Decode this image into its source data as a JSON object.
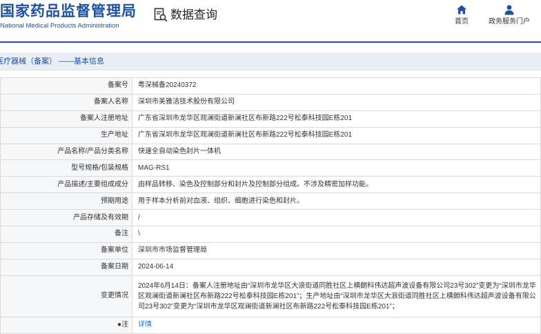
{
  "header": {
    "logo_cn": "国家药品监督管理局",
    "logo_en": "National Medical Products Administration",
    "data_query": "数据查询",
    "nav": {
      "home": "首页",
      "portal": "政务服务门户"
    }
  },
  "section": {
    "title": "医疗器械（备案） ——基本信息"
  },
  "colors": {
    "brand": "#1d4fa3",
    "link": "#1d6fd1"
  },
  "rows": [
    {
      "label": "备案号",
      "value": "粤深械备20240372"
    },
    {
      "label": "备案人名称",
      "value": "深圳市美雅洁技术股份有限公司"
    },
    {
      "label": "备案人注册地址",
      "value": "广东省深圳市龙华区观澜街道新澜社区布新路222号松泰科技园E栋201"
    },
    {
      "label": "生产地址",
      "value": "广东省深圳市龙华区观澜街道新澜社区布新路222号松泰科技园E栋201"
    },
    {
      "label": "产品名称/产品分类名称",
      "value": "快速全自动染色封片一体机"
    },
    {
      "label": "型号规格/包装规格",
      "value": "MAG-RS1"
    },
    {
      "label": "产品描述/主要组成成分",
      "value": "由样品转移、染色及控制部分和封片及控制部分组成。不涉及精密加样功能。"
    },
    {
      "label": "预期用途",
      "value": "用于样本分析前对血液、组织、细胞进行染色和封片。"
    },
    {
      "label": "产品存储及有效期",
      "value": "/"
    },
    {
      "label": "备注",
      "value": "\\"
    },
    {
      "label": "备案单位",
      "value": "深圳市市场监督管理局"
    },
    {
      "label": "备案日期",
      "value": "2024-06-14"
    },
    {
      "label": "变更情况",
      "value": "2024年6月14日：备案人注册地址由“深圳市龙华区大浪街道同胜社区上横朗科伟达超声波设备有限公司23号302”变更为“深圳市龙华区观澜街道新澜社区布新路222号松泰科技园E栋201”；生产地址由“深圳市龙华区大浪街道同胜社区上横朗科伟达超声波设备有限公司23号302”变更为“深圳市龙华区观澜街道新澜社区布新路222号松泰科技园E栋201”；"
    },
    {
      "label": "●注",
      "value": "详情"
    }
  ]
}
